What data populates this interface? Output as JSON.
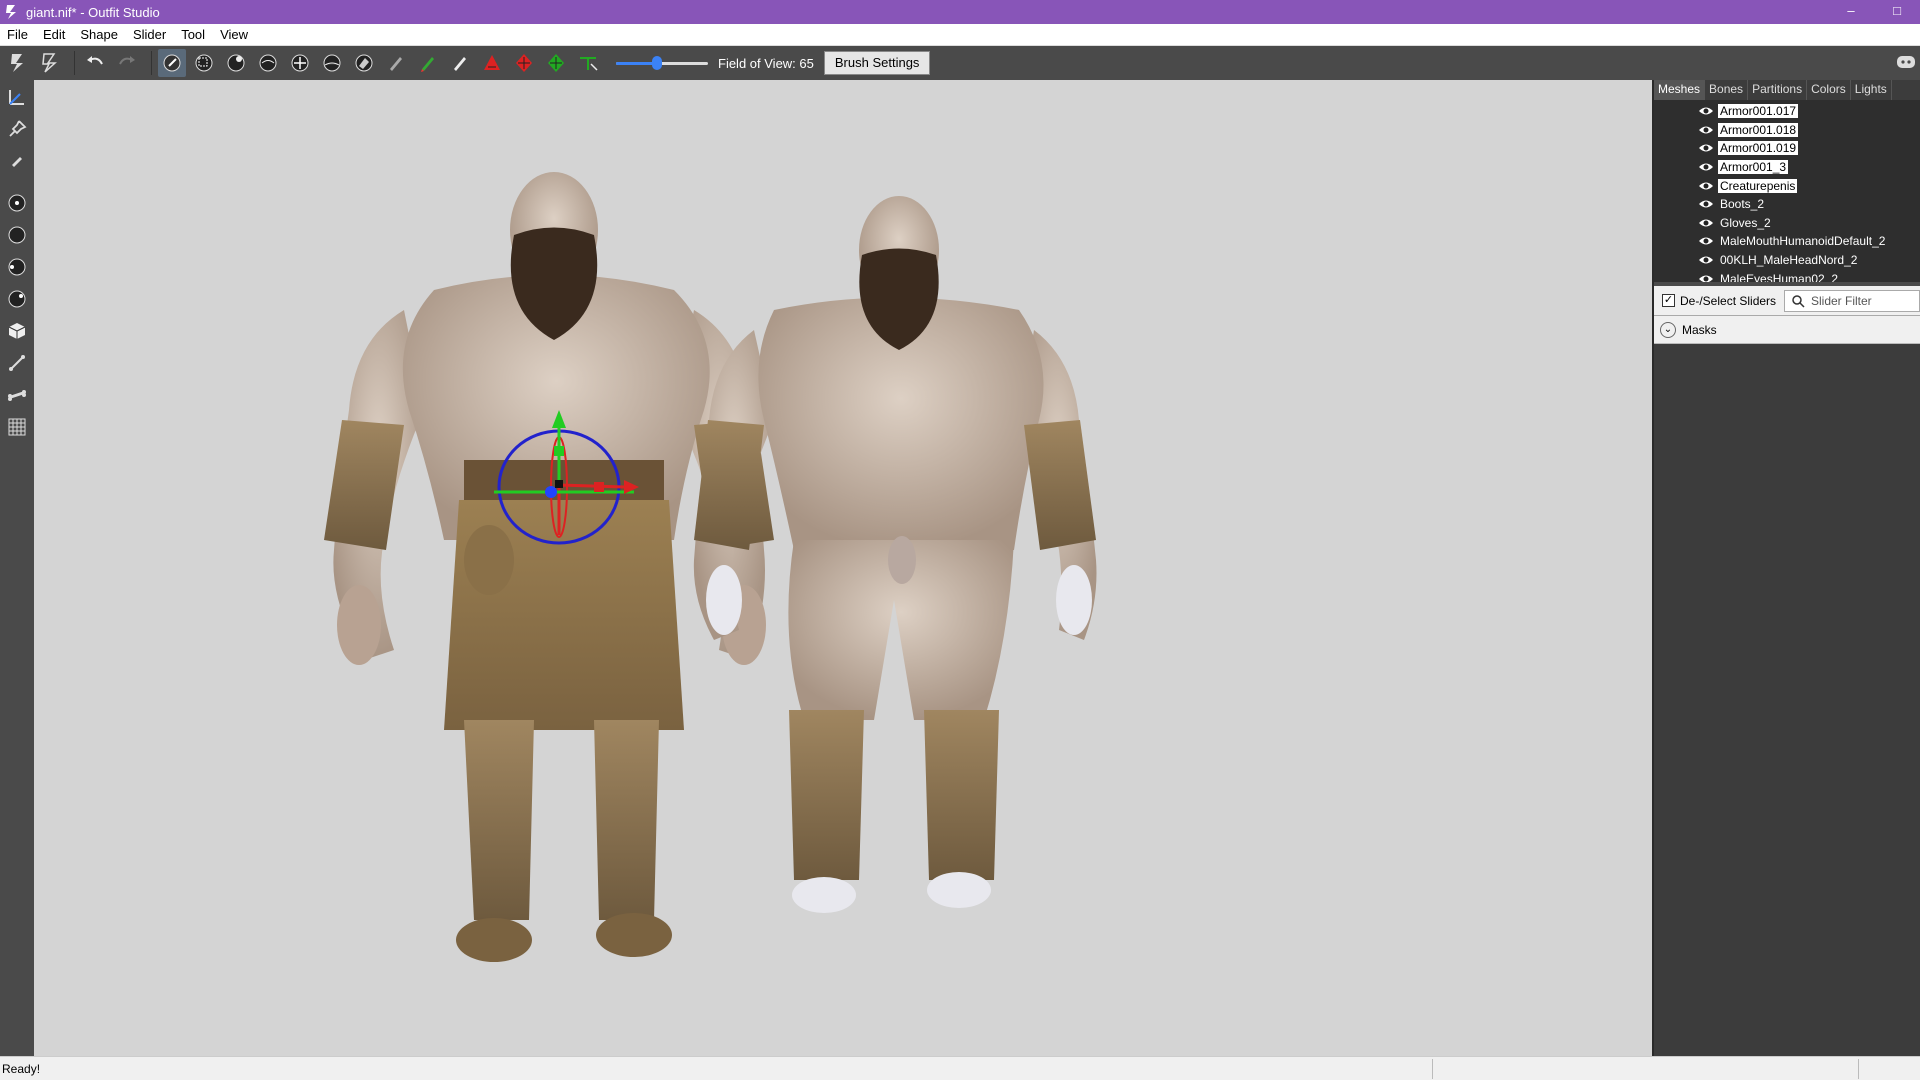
{
  "window": {
    "title": "giant.nif* - Outfit Studio",
    "minimize": "–",
    "close": "□"
  },
  "menu": [
    "File",
    "Edit",
    "Shape",
    "Slider",
    "Tool",
    "View"
  ],
  "toolbar": {
    "fov_label": "Field of View: 65",
    "fov_value": 0.45,
    "brush_settings": "Brush Settings"
  },
  "panel": {
    "tabs": [
      "Meshes",
      "Bones",
      "Partitions",
      "Colors",
      "Lights"
    ],
    "active_tab": "Meshes",
    "meshes": [
      {
        "name": "Armor001.017",
        "selected": true
      },
      {
        "name": "Armor001.018",
        "selected": true
      },
      {
        "name": "Armor001.019",
        "selected": true
      },
      {
        "name": "Armor001_3",
        "selected": true
      },
      {
        "name": "Creaturepenis",
        "selected": true
      },
      {
        "name": "Boots_2",
        "selected": false
      },
      {
        "name": "Gloves_2",
        "selected": false
      },
      {
        "name": "MaleMouthHumanoidDefault_2",
        "selected": false
      },
      {
        "name": "00KLH_MaleHeadNord_2",
        "selected": false
      },
      {
        "name": "MaleEyesHuman02_2",
        "selected": false
      }
    ],
    "deselect_label": "De-/Select Sliders",
    "deselect_checked": "✓",
    "filter_placeholder": "Slider Filter",
    "masks_label": "Masks"
  },
  "status": {
    "text": "Ready!"
  },
  "colors": {
    "titlebar": "#8855b8",
    "toolbar": "#4a4a4a",
    "viewport": "#d4d4d4",
    "gizmo_ring": "#2222cc",
    "gizmo_x": "#dd2222",
    "gizmo_y": "#22cc22",
    "skin": "#c8b4a4",
    "fur": "#8a7350",
    "beard": "#3a2a1e"
  }
}
